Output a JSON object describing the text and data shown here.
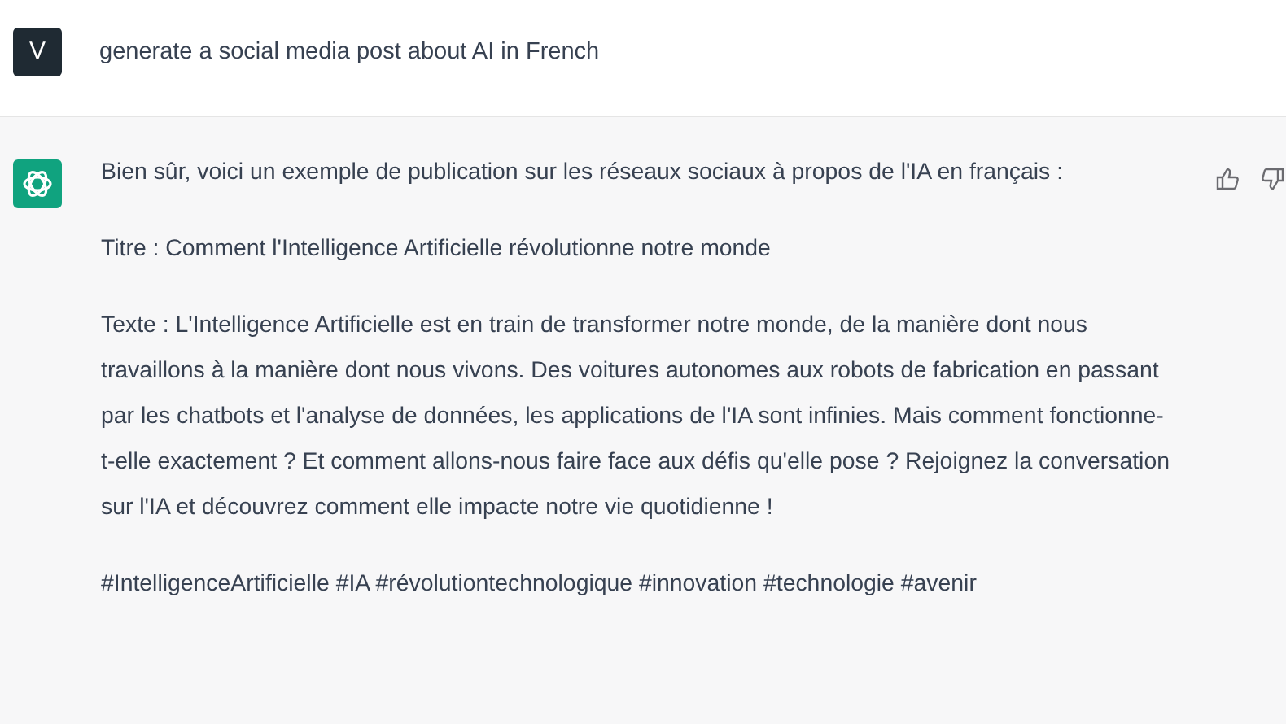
{
  "user_message": {
    "avatar": "V",
    "text": "generate a social media post about AI in French"
  },
  "reply": {
    "paragraphs": [
      "Bien sûr, voici un exemple de publication sur les réseaux sociaux à propos de l'IA en français :",
      "Titre : Comment l'Intelligence Artificielle révolutionne notre monde",
      "Texte : L'Intelligence Artificielle est en train de transformer notre monde, de la manière dont nous travaillons à la manière dont nous vivons. Des voitures autonomes aux robots de fabrication en passant par les chatbots et l'analyse de données, les applications de l'IA sont infinies. Mais comment fonctionne-t-elle exactement ? Et comment allons-nous faire face aux défis qu'elle pose ? Rejoignez la conversation sur l'IA et découvrez comment elle impacte notre vie quotidienne !",
      "#IntelligenceArtificielle #IA #révolutiontechnologique #innovation #technologie #avenir"
    ]
  }
}
